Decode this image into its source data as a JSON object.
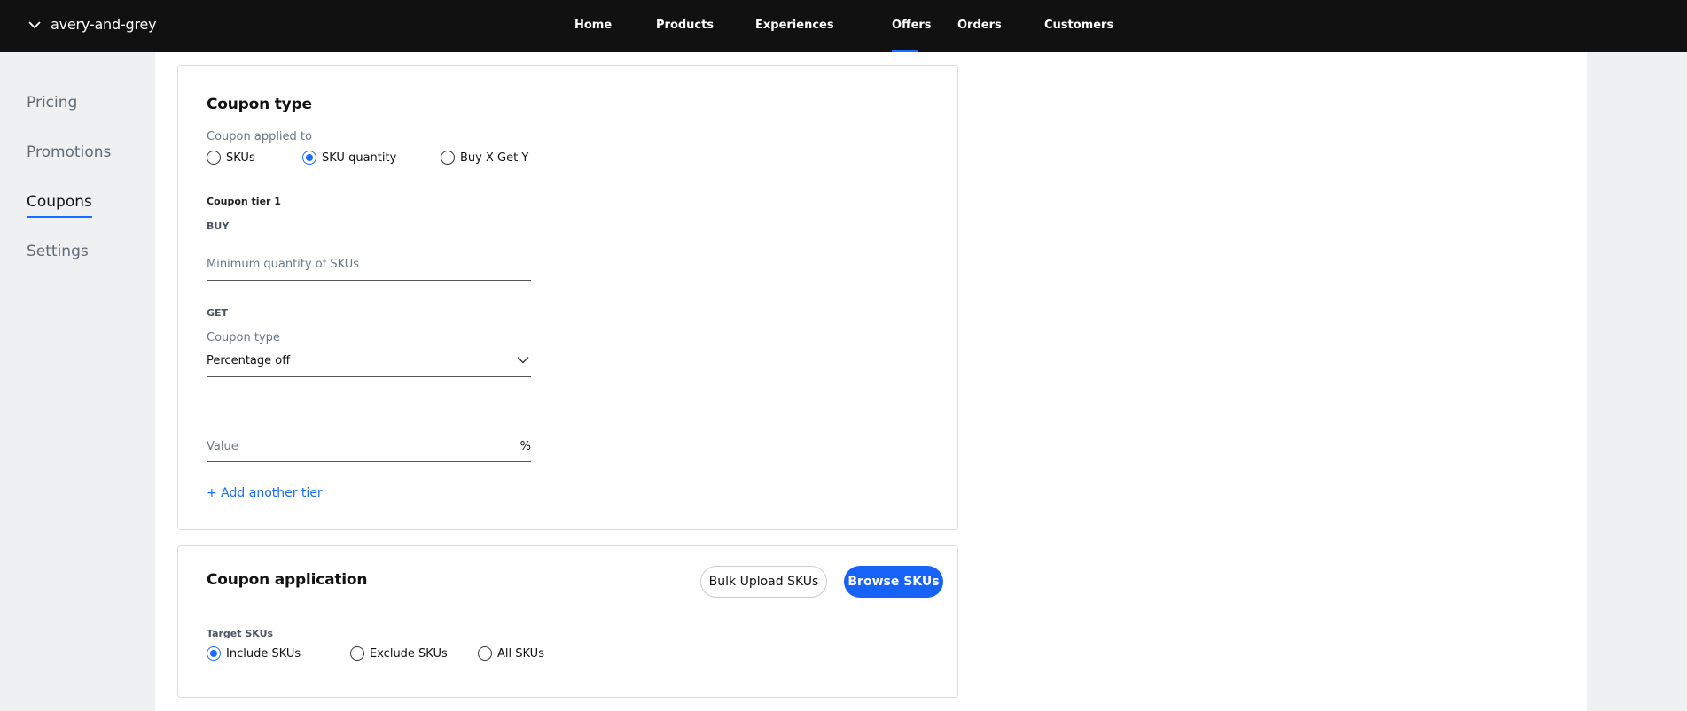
{
  "topbar": {
    "store_name": "avery-and-grey",
    "nav": [
      {
        "label": "Home"
      },
      {
        "label": "Products"
      },
      {
        "label": "Experiences"
      },
      {
        "label": "Offers"
      },
      {
        "label": "Orders"
      },
      {
        "label": "Customers"
      }
    ],
    "active_nav": "Offers"
  },
  "sidebar": {
    "items": [
      {
        "label": "Pricing"
      },
      {
        "label": "Promotions"
      },
      {
        "label": "Coupons"
      },
      {
        "label": "Settings"
      }
    ],
    "active": "Coupons"
  },
  "coupon_type": {
    "title": "Coupon type",
    "applied_to_label": "Coupon applied to",
    "options": [
      {
        "label": "SKUs",
        "checked": false
      },
      {
        "label": "SKU quantity",
        "checked": true
      },
      {
        "label": "Buy X Get Y",
        "checked": false
      }
    ],
    "tier_title": "Coupon tier 1",
    "buy_label": "BUY",
    "min_qty_placeholder": "Minimum quantity of SKUs",
    "get_label": "GET",
    "type_label": "Coupon type",
    "type_value": "Percentage off",
    "value_placeholder": "Value",
    "value_suffix": "%",
    "add_tier": "+ Add another tier"
  },
  "coupon_application": {
    "title": "Coupon application",
    "bulk_upload": "Bulk Upload SKUs",
    "browse": "Browse SKUs",
    "target_label": "Target SKUs",
    "options": [
      {
        "label": "Include SKUs",
        "checked": true
      },
      {
        "label": "Exclude SKUs",
        "checked": false
      },
      {
        "label": "All SKUs",
        "checked": false
      }
    ]
  },
  "colors": {
    "accent": "#1a6bff",
    "topbar": "#111111",
    "page_bg": "#eef0f1"
  }
}
